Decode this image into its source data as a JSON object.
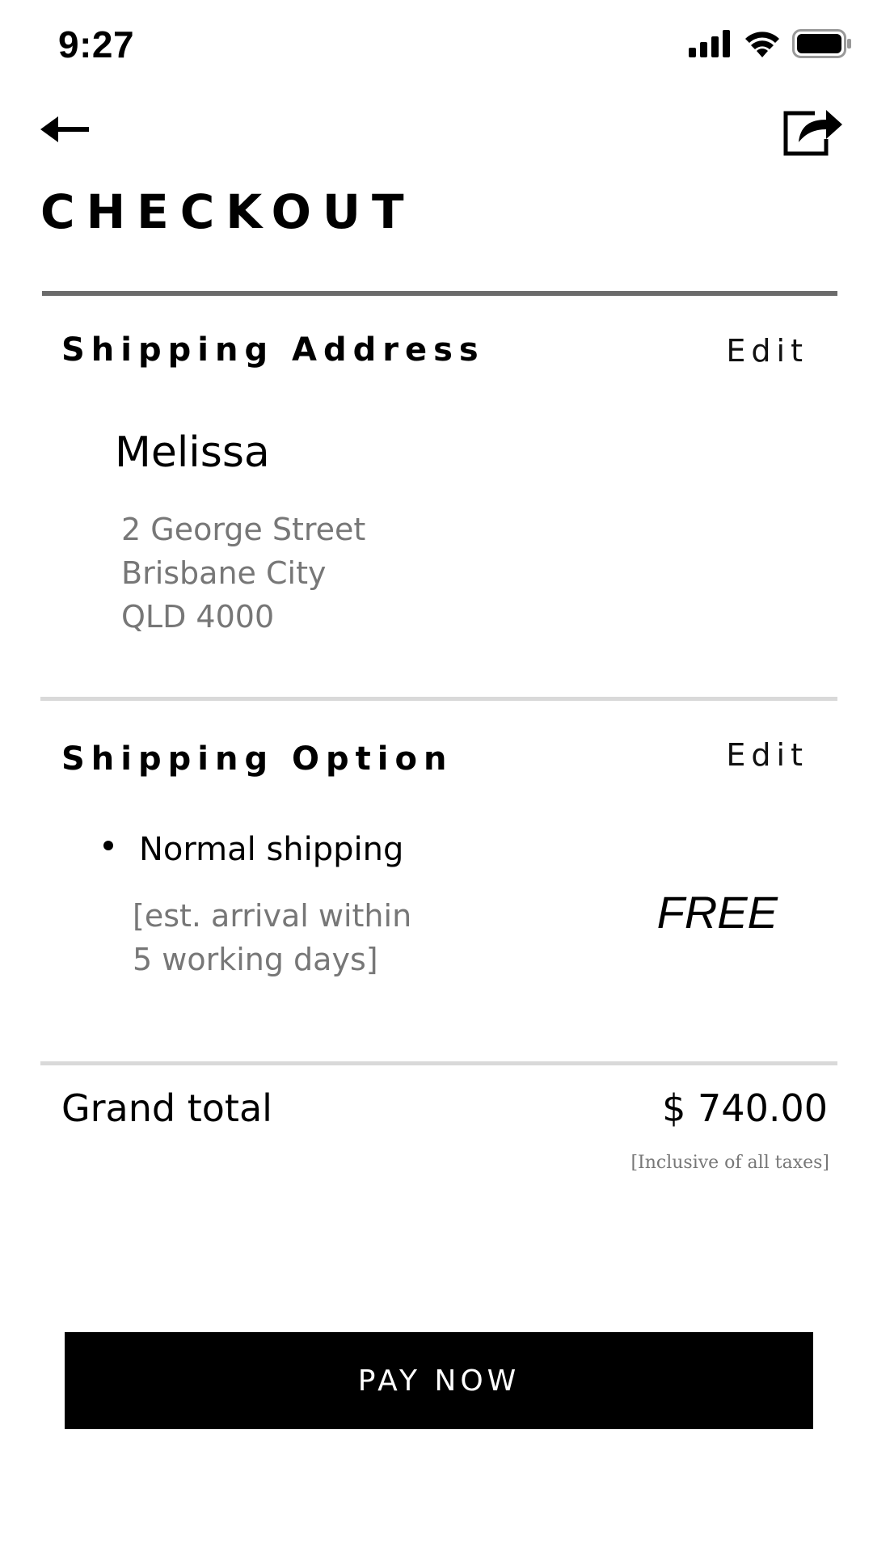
{
  "status_bar": {
    "time": "9:27",
    "icons": [
      "cellular-signal-icon",
      "wifi-icon",
      "battery-icon"
    ]
  },
  "nav": {
    "back_icon": "back-arrow-icon",
    "share_icon": "share-icon"
  },
  "page_title": "CHECKOUT",
  "shipping_address": {
    "title": "Shipping Address",
    "edit_label": "Edit",
    "name": "Melissa",
    "line1": "2 George Street",
    "line2": "Brisbane City",
    "line3": "QLD 4000"
  },
  "shipping_option": {
    "title": "Shipping Option",
    "edit_label": "Edit",
    "method": "Normal shipping",
    "est_line1": "[est. arrival within",
    "est_line2": "5 working days]",
    "price": "FREE"
  },
  "total": {
    "label": "Grand total",
    "value": "$ 740.00",
    "note": "[Inclusive of  all taxes]"
  },
  "pay_button": {
    "label": "PAY NOW"
  },
  "colors": {
    "accent": "#000000",
    "muted_text": "#777777",
    "divider": "#d9d9d9",
    "divider_strong": "#6b6b6b"
  }
}
